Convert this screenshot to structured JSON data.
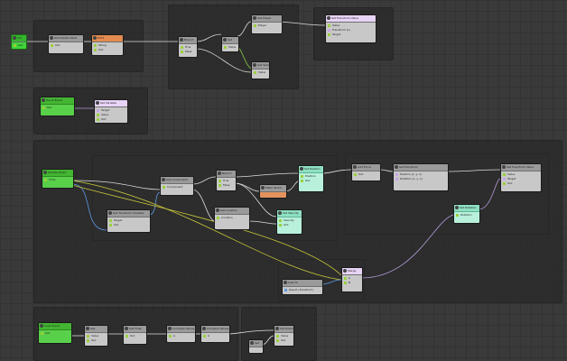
{
  "graph": {
    "start_node": {
      "title": "Init",
      "out_label": "Out"
    },
    "row1": [
      {
        "title": "OnInitialize Start",
        "rows": [
          "Out"
        ]
      },
      {
        "title": "Print",
        "rows": [
          "String",
          "Out"
        ]
      },
      {
        "title": "Branch",
        "rows": [
          "In",
          "True",
          "False"
        ]
      },
      {
        "title": "Set",
        "rows": [
          "Value",
          "Out"
        ]
      },
      {
        "title": "Get Player",
        "rows": [
          "Out",
          "Player"
        ]
      },
      {
        "title": "Get Variable",
        "rows": [
          "Value"
        ]
      },
      {
        "title": "Set Transform Value",
        "rows": [
          "Value",
          "Transform (L)",
          "Target"
        ]
      }
    ],
    "event_node": {
      "title": "Touch Event",
      "rows": [
        "Out"
      ]
    },
    "event_handler": {
      "title": "Set Variable",
      "rows": [
        "Target",
        "Value",
        "Out"
      ]
    },
    "main_event": {
      "title": "Update Event",
      "rows": [
        "Out",
        "Time"
      ]
    },
    "inner_nodes": [
      {
        "title": "Get Component",
        "rows": [
          "Component",
          "Out"
        ]
      },
      {
        "title": "Get Transform Variable",
        "rows": [
          "Target",
          "Out"
        ]
      },
      {
        "title": "Branch",
        "rows": [
          "In",
          "True",
          "False"
        ]
      },
      {
        "title": "Make Vector",
        "rows": [
          "X",
          "Y",
          "Z"
        ]
      },
      {
        "title": "Set Position",
        "rows": [
          "Position",
          "Out"
        ]
      },
      {
        "title": "Get Location",
        "rows": [
          "Location"
        ]
      },
      {
        "title": "Set Velocity",
        "rows": [
          "Velocity",
          "Out"
        ]
      },
      {
        "title": "Add Force",
        "rows": [
          "Force",
          "Out"
        ]
      },
      {
        "title": "Set Transform",
        "rows": [
          "Transform",
          "Position (x, y, z)",
          "Rotation (x, y, z)"
        ]
      },
      {
        "title": "Set Transform Value",
        "rows": [
          "Value",
          "Target",
          "Out"
        ]
      },
      {
        "title": "Set Rotation",
        "rows": [
          "Rotation",
          "Out"
        ]
      }
    ],
    "bottom_event": {
      "title": "Loop Event",
      "rows": [
        "Out"
      ]
    },
    "bottom_nodes": [
      {
        "title": "Get",
        "rows": [
          "Value",
          "Out"
        ]
      },
      {
        "title": "Get Float",
        "rows": [
          "Value",
          "Out"
        ]
      },
      {
        "title": "Compare Values",
        "rows": [
          "A",
          "B"
        ]
      },
      {
        "title": "Compare Values",
        "rows": [
          "A",
          "B"
        ]
      },
      {
        "title": "Set",
        "rows": [
          "Value"
        ]
      },
      {
        "title": "Set Output",
        "rows": [
          "Value",
          "Out"
        ]
      }
    ],
    "merge_node": {
      "title": "Merge",
      "rows": [
        "A",
        "B",
        "Out"
      ]
    },
    "cast_node": {
      "title": "Cast To",
      "rows": [
        "Object",
        "Result (Transform)"
      ]
    }
  },
  "colors": {
    "canvas": "#3a3a3a",
    "group": "#282828",
    "node_body": "#c8c8c8",
    "event_green": "#59d04a",
    "teal": "#b8f0dc",
    "orange": "#e38b4f",
    "wire_white": "#dcdcdc",
    "wire_purple": "#b49ad8",
    "wire_yellow": "#c9c83a"
  }
}
